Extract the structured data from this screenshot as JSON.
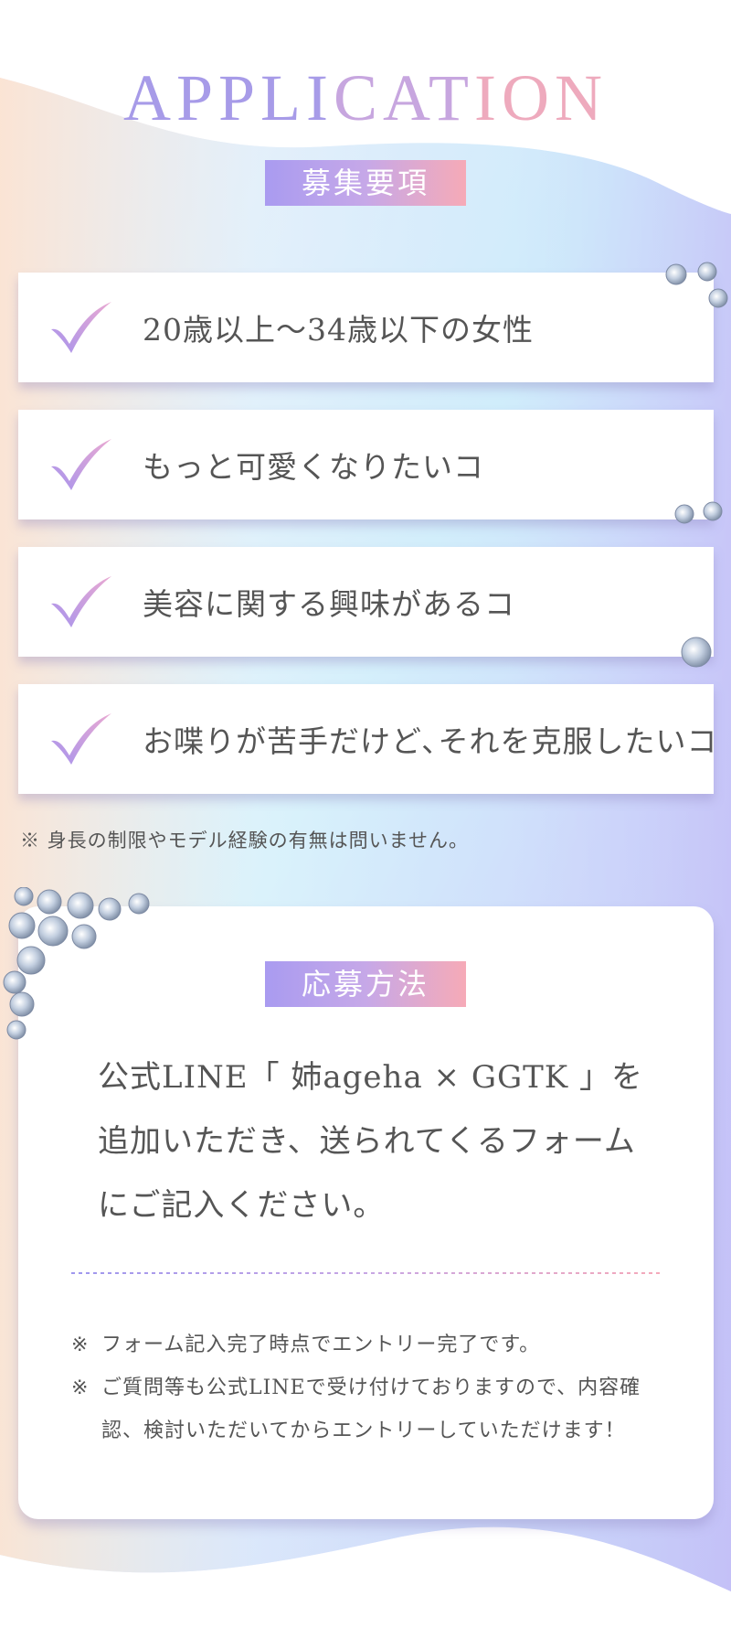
{
  "header": {
    "title_left": "APPLI",
    "title_mid": "CAT",
    "title_right": "ION"
  },
  "requirements": {
    "heading": "募集要項",
    "items": [
      "20歳以上～34歳以下の女性",
      "もっと可愛くなりたいコ",
      "美容に関する興味があるコ",
      "お喋りが苦手だけど､それを克服したいコ"
    ],
    "note": "※ 身長の制限やモデル経験の有無は問いません。"
  },
  "application": {
    "heading": "応募方法",
    "body_lines": [
      "公式LINE「 姉ageha × GGTK 」を",
      "追加いただき、送られてくるフォーム",
      "にご記入ください。"
    ],
    "notes": [
      {
        "mark": "※",
        "text": "フォーム記入完了時点でエントリー完了です。"
      },
      {
        "mark": "※",
        "text": "ご質問等も公式LINEで受け付けておりますので、内容確認、検討いただいてからエントリーしていただけます！"
      }
    ]
  },
  "colors": {
    "gradient_start": "#a99bf0",
    "gradient_mid": "#c6a8e8",
    "gradient_end": "#f6aab7",
    "text": "#555555"
  },
  "icons": {
    "check": "check-mark-icon",
    "gem": "diamond-icon"
  }
}
